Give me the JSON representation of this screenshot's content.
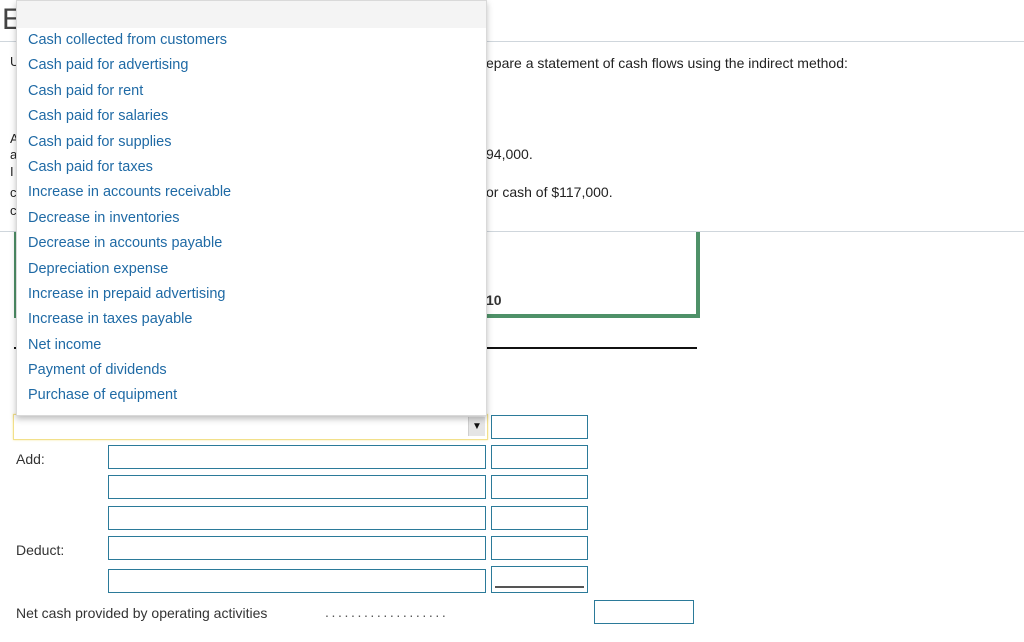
{
  "heading": {
    "letter": "E"
  },
  "background_text": {
    "instruction_fragment": "epare a statement of cash flows using the indirect method:",
    "line_fragment_1": "94,000.",
    "line_fragment_2": "or cash of $117,000.",
    "panel_number_fragment": "10",
    "edge_chars": [
      "U",
      "A",
      "a",
      "I",
      "c",
      "c"
    ]
  },
  "dropdown": {
    "selected": "",
    "options": [
      "Cash collected from customers",
      "Cash paid for advertising",
      "Cash paid for rent",
      "Cash paid for salaries",
      "Cash paid for supplies",
      "Cash paid for taxes",
      "Increase in accounts receivable",
      "Decrease in inventories",
      "Decrease in accounts payable",
      "Depreciation expense",
      "Increase in prepaid advertising",
      "Increase in taxes payable",
      "Net income",
      "Payment of dividends",
      "Purchase of equipment"
    ],
    "arrow_icon": "▼"
  },
  "form": {
    "add_label": "Add:",
    "deduct_label": "Deduct:",
    "net_cash_label": "Net cash provided by operating activities",
    "dot_leader": "...................",
    "rows": [
      {
        "description": "",
        "amount": ""
      },
      {
        "description": "",
        "amount": ""
      },
      {
        "description": "",
        "amount": ""
      },
      {
        "description": "",
        "amount": ""
      },
      {
        "description": "",
        "amount": ""
      }
    ],
    "first_row_amount": "",
    "net_cash_amount": ""
  }
}
